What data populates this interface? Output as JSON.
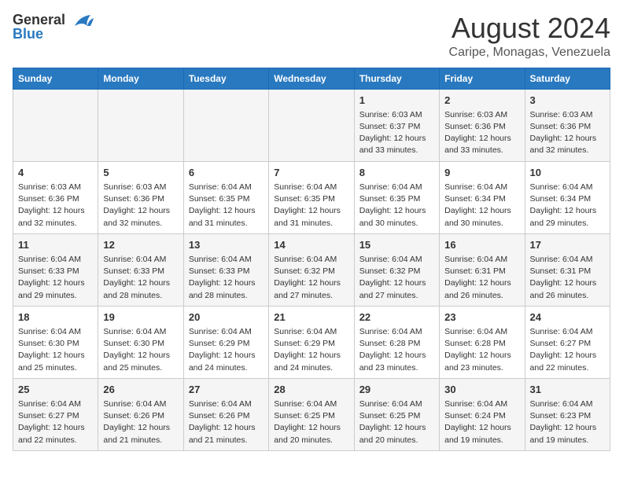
{
  "header": {
    "logo_line1": "General",
    "logo_line2": "Blue",
    "title": "August 2024",
    "subtitle": "Caripe, Monagas, Venezuela"
  },
  "days_of_week": [
    "Sunday",
    "Monday",
    "Tuesday",
    "Wednesday",
    "Thursday",
    "Friday",
    "Saturday"
  ],
  "weeks": [
    [
      {
        "day": "",
        "info": ""
      },
      {
        "day": "",
        "info": ""
      },
      {
        "day": "",
        "info": ""
      },
      {
        "day": "",
        "info": ""
      },
      {
        "day": "1",
        "info": "Sunrise: 6:03 AM\nSunset: 6:37 PM\nDaylight: 12 hours\nand 33 minutes."
      },
      {
        "day": "2",
        "info": "Sunrise: 6:03 AM\nSunset: 6:36 PM\nDaylight: 12 hours\nand 33 minutes."
      },
      {
        "day": "3",
        "info": "Sunrise: 6:03 AM\nSunset: 6:36 PM\nDaylight: 12 hours\nand 32 minutes."
      }
    ],
    [
      {
        "day": "4",
        "info": "Sunrise: 6:03 AM\nSunset: 6:36 PM\nDaylight: 12 hours\nand 32 minutes."
      },
      {
        "day": "5",
        "info": "Sunrise: 6:03 AM\nSunset: 6:36 PM\nDaylight: 12 hours\nand 32 minutes."
      },
      {
        "day": "6",
        "info": "Sunrise: 6:04 AM\nSunset: 6:35 PM\nDaylight: 12 hours\nand 31 minutes."
      },
      {
        "day": "7",
        "info": "Sunrise: 6:04 AM\nSunset: 6:35 PM\nDaylight: 12 hours\nand 31 minutes."
      },
      {
        "day": "8",
        "info": "Sunrise: 6:04 AM\nSunset: 6:35 PM\nDaylight: 12 hours\nand 30 minutes."
      },
      {
        "day": "9",
        "info": "Sunrise: 6:04 AM\nSunset: 6:34 PM\nDaylight: 12 hours\nand 30 minutes."
      },
      {
        "day": "10",
        "info": "Sunrise: 6:04 AM\nSunset: 6:34 PM\nDaylight: 12 hours\nand 29 minutes."
      }
    ],
    [
      {
        "day": "11",
        "info": "Sunrise: 6:04 AM\nSunset: 6:33 PM\nDaylight: 12 hours\nand 29 minutes."
      },
      {
        "day": "12",
        "info": "Sunrise: 6:04 AM\nSunset: 6:33 PM\nDaylight: 12 hours\nand 28 minutes."
      },
      {
        "day": "13",
        "info": "Sunrise: 6:04 AM\nSunset: 6:33 PM\nDaylight: 12 hours\nand 28 minutes."
      },
      {
        "day": "14",
        "info": "Sunrise: 6:04 AM\nSunset: 6:32 PM\nDaylight: 12 hours\nand 27 minutes."
      },
      {
        "day": "15",
        "info": "Sunrise: 6:04 AM\nSunset: 6:32 PM\nDaylight: 12 hours\nand 27 minutes."
      },
      {
        "day": "16",
        "info": "Sunrise: 6:04 AM\nSunset: 6:31 PM\nDaylight: 12 hours\nand 26 minutes."
      },
      {
        "day": "17",
        "info": "Sunrise: 6:04 AM\nSunset: 6:31 PM\nDaylight: 12 hours\nand 26 minutes."
      }
    ],
    [
      {
        "day": "18",
        "info": "Sunrise: 6:04 AM\nSunset: 6:30 PM\nDaylight: 12 hours\nand 25 minutes."
      },
      {
        "day": "19",
        "info": "Sunrise: 6:04 AM\nSunset: 6:30 PM\nDaylight: 12 hours\nand 25 minutes."
      },
      {
        "day": "20",
        "info": "Sunrise: 6:04 AM\nSunset: 6:29 PM\nDaylight: 12 hours\nand 24 minutes."
      },
      {
        "day": "21",
        "info": "Sunrise: 6:04 AM\nSunset: 6:29 PM\nDaylight: 12 hours\nand 24 minutes."
      },
      {
        "day": "22",
        "info": "Sunrise: 6:04 AM\nSunset: 6:28 PM\nDaylight: 12 hours\nand 23 minutes."
      },
      {
        "day": "23",
        "info": "Sunrise: 6:04 AM\nSunset: 6:28 PM\nDaylight: 12 hours\nand 23 minutes."
      },
      {
        "day": "24",
        "info": "Sunrise: 6:04 AM\nSunset: 6:27 PM\nDaylight: 12 hours\nand 22 minutes."
      }
    ],
    [
      {
        "day": "25",
        "info": "Sunrise: 6:04 AM\nSunset: 6:27 PM\nDaylight: 12 hours\nand 22 minutes."
      },
      {
        "day": "26",
        "info": "Sunrise: 6:04 AM\nSunset: 6:26 PM\nDaylight: 12 hours\nand 21 minutes."
      },
      {
        "day": "27",
        "info": "Sunrise: 6:04 AM\nSunset: 6:26 PM\nDaylight: 12 hours\nand 21 minutes."
      },
      {
        "day": "28",
        "info": "Sunrise: 6:04 AM\nSunset: 6:25 PM\nDaylight: 12 hours\nand 20 minutes."
      },
      {
        "day": "29",
        "info": "Sunrise: 6:04 AM\nSunset: 6:25 PM\nDaylight: 12 hours\nand 20 minutes."
      },
      {
        "day": "30",
        "info": "Sunrise: 6:04 AM\nSunset: 6:24 PM\nDaylight: 12 hours\nand 19 minutes."
      },
      {
        "day": "31",
        "info": "Sunrise: 6:04 AM\nSunset: 6:23 PM\nDaylight: 12 hours\nand 19 minutes."
      }
    ]
  ]
}
